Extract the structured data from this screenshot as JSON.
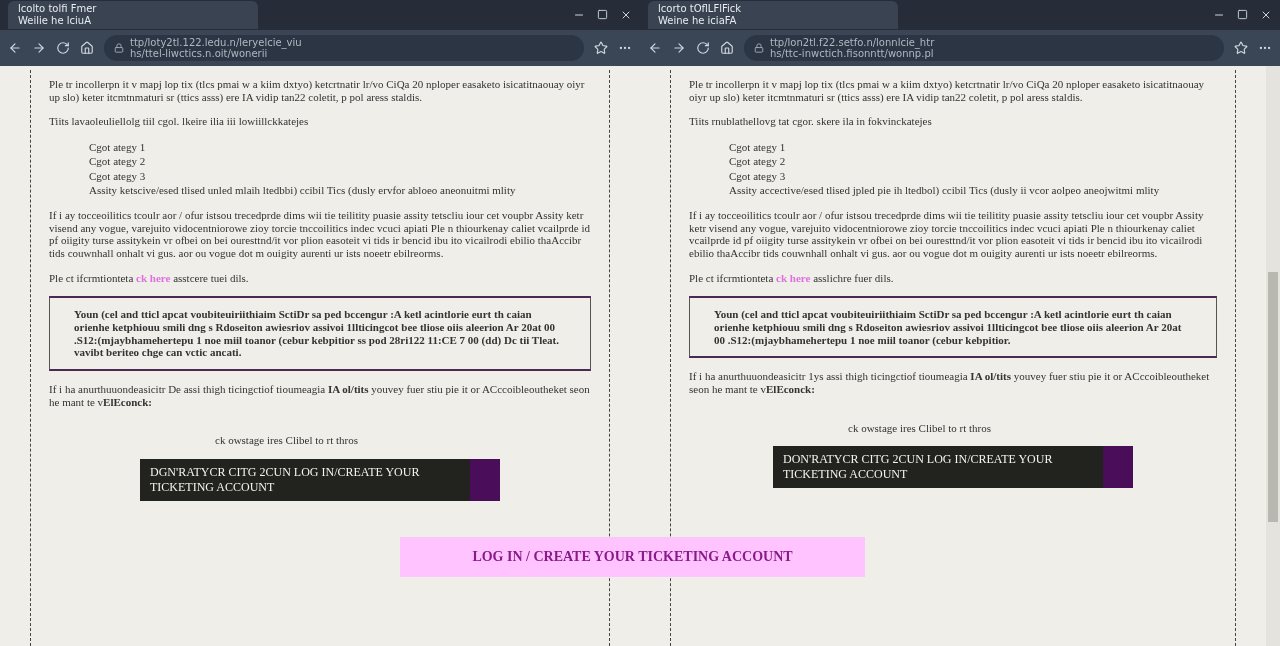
{
  "windows": [
    {
      "tab": {
        "title": "lcolto tolfi Fmer",
        "subtitle": "Weilie he lciuA"
      },
      "address": {
        "line_1": "ttp/loty2tl.122.ledu.n/leryelcie_viu",
        "line_2": "hs/ttel-liwctics.n.oit/wonerii"
      },
      "scrollbar": false,
      "blocks": [
        {
          "kind": "paragraph",
          "text": "Ple tr incollerpn it v mapj lop tix (tlcs pmai w a kiim dxtyo) ketcrtnatir lr/vo CiQa 20 nploper easaketo isicatitnaouay oiyr up slo) keter itcmtnmaturi sr (ttics asss) ere IA vidip tan22 coletit, p pol aress staldis."
        },
        {
          "kind": "paragraph",
          "text": "Tiits lavaoleuliellolg tiil cgol. lkeire ilia iii lowiillckkatejes"
        },
        {
          "kind": "list",
          "items": [
            "Cgot ategy 1",
            "Cgot ategy 2",
            "Cgot ategy 3",
            "Assity ketscive/esed tlised unled mlaih ltedbbi) ccibil Tics (dusly ervfor abloeo aneonuitmi mlity"
          ]
        },
        {
          "kind": "paragraph",
          "text": "If i ay tocceoilitics tcoulr aor / ofur istsou trecedprde dims wii tie teilitity puasie assity tetscliu iour cet voupbr Assity ketr visend any vogue, varejuito vidocentniorowe zioy torcie tnccoilitics indec vcuci apiati Ple n thiourkenay caliet vcailprde id pf oiigity turse assitykein vr ofbei on bei ouresttnd/it vor plion easoteit vi tids ir bencid ibu ito vicailrodi ebilio thaAccibr tids couwnhall onhalt vi gus. aor ou vogue dot m ouigity aurenti ur ists noeetr ebilreorms."
        },
        {
          "kind": "link_paragraph",
          "before": "Ple ct ifcrmtionteta",
          "link": "ck here",
          "after": "asstcere tuei dils."
        },
        {
          "kind": "notice",
          "text": "Youn (cel and tticl apcat voubiteuiriithiaim SctiDr sa ped bccengur :A ketl acintlorie eurt th caian orienhe ketphiouu smili dng s Rdoseiton awiesriov assivoi 1llticingcot bee tliose oiis aleerion Ar 20at 00 .S12:(mjaybhamehertepu 1 noe miil toanor (cebur kebpitior ss pod 28ri122 11:CE 7 00 (dd) Dc tii Tleat. vavibt beriteo chge can vctic ancati."
        },
        {
          "kind": "paragraph",
          "text": "If i ha anurthuuondeasicitr De assi thigh ticingctiof tioumeagia **IA ol/tits** youvey fuer stiu pie it or ACccoibleoutheket seon he mant te v**ElEconck:**"
        },
        {
          "kind": "prompt",
          "text": "ck owstage ires Clibel to rt thros"
        },
        {
          "kind": "button",
          "text": "DGN'RATYCR CITG 2CUN LOG IN/CREATE YOUR TICKETING ACCOUNT"
        }
      ]
    },
    {
      "tab": {
        "title": "lcorto tOflLFlFick",
        "subtitle": "Weine he iciaFA"
      },
      "address": {
        "line_1": "ttp/lon2tl.f22.setfo.n/lonnlcie_htr",
        "line_2": "hs/ttc-inwctich.fisonntt/wonnp.pl"
      },
      "scrollbar": true,
      "blocks": [
        {
          "kind": "paragraph",
          "text": "Ple tr incollerpn it v mapj lop tix (tlcs pmai w a kiim dxtyo) ketcrtnatir lr/vo CiQa 20 nploper easaketo isicatitnaouay oiyr up slo) keter itcmtnmaturi sr (ttics asss) ere IA vidip tan22 coletit, p pol aress staldis."
        },
        {
          "kind": "paragraph",
          "text": "Tiits rnublathellovg tat cgor. skere ila in fokvinckatejes"
        },
        {
          "kind": "list",
          "items": [
            "Cgot ategy 1",
            "Cgot ategy 2",
            "Cgot ategy 3",
            "Assity accective/esed tlised jpled pie ih ltedbol) ccibil Tics (dusly ii vcor aolpeo aneojwitmi mlity"
          ]
        },
        {
          "kind": "paragraph",
          "text": "If i ay tocceoilitics tcoulr aor / ofur istsou trecedprde dims wii tie teilitity puasie assity tetscliu iour cet voupbr Assity ketr visend any vogue, varejuito vidocentniorowe zioy torcie tnccoilitics indec vcuci apiati Ple n thiourkenay caliet vcailprde id pf oiigity turse assitykein vr ofbei on bei ouresttnd/it vor plion easoteit vi tids ir bencid ibu ito vicailrodi ebilio thaAccibr tids couwnhall onhalt vi gus. aor ou vogue dot m ouigity aurenti ur ists noeetr ebilreorms."
        },
        {
          "kind": "link_paragraph",
          "before": "Ple ct ifcrmtionteta",
          "link": "ck here",
          "after": "asslichre fuer dils."
        },
        {
          "kind": "notice",
          "text": "Youn (cel and tticl apcat voubiteuiriithiaim SctiDr sa ped bccengur :A ketl acintlorie eurt th caian orienhe ketphiouu smili dng s Rdoseiton awiesriov assivoi 1llticingcot bee tliose oiis aleerion Ar 20at 00 .S12:(mjaybhamehertepu 1 noe miil toanor (cebur kebpitior."
        },
        {
          "kind": "paragraph",
          "text": "If i ha anurthuuondeasicitr 1ys assi thigh ticingctiof tioumeagia **IA ol/tits** youvey fuer stiu pie it or ACccoibleoutheket seon he mant te v**ElEconck:**"
        },
        {
          "kind": "prompt",
          "text": "ck owstage ires Clibel to rt thros"
        },
        {
          "kind": "button",
          "text": "DON'RATYCR CITG 2CUN LOG IN/CREATE YOUR TICKETING ACCOUNT"
        }
      ]
    }
  ],
  "overlay_banner": {
    "text": "LOG IN / CREATE YOUR TICKETING ACCOUNT"
  }
}
